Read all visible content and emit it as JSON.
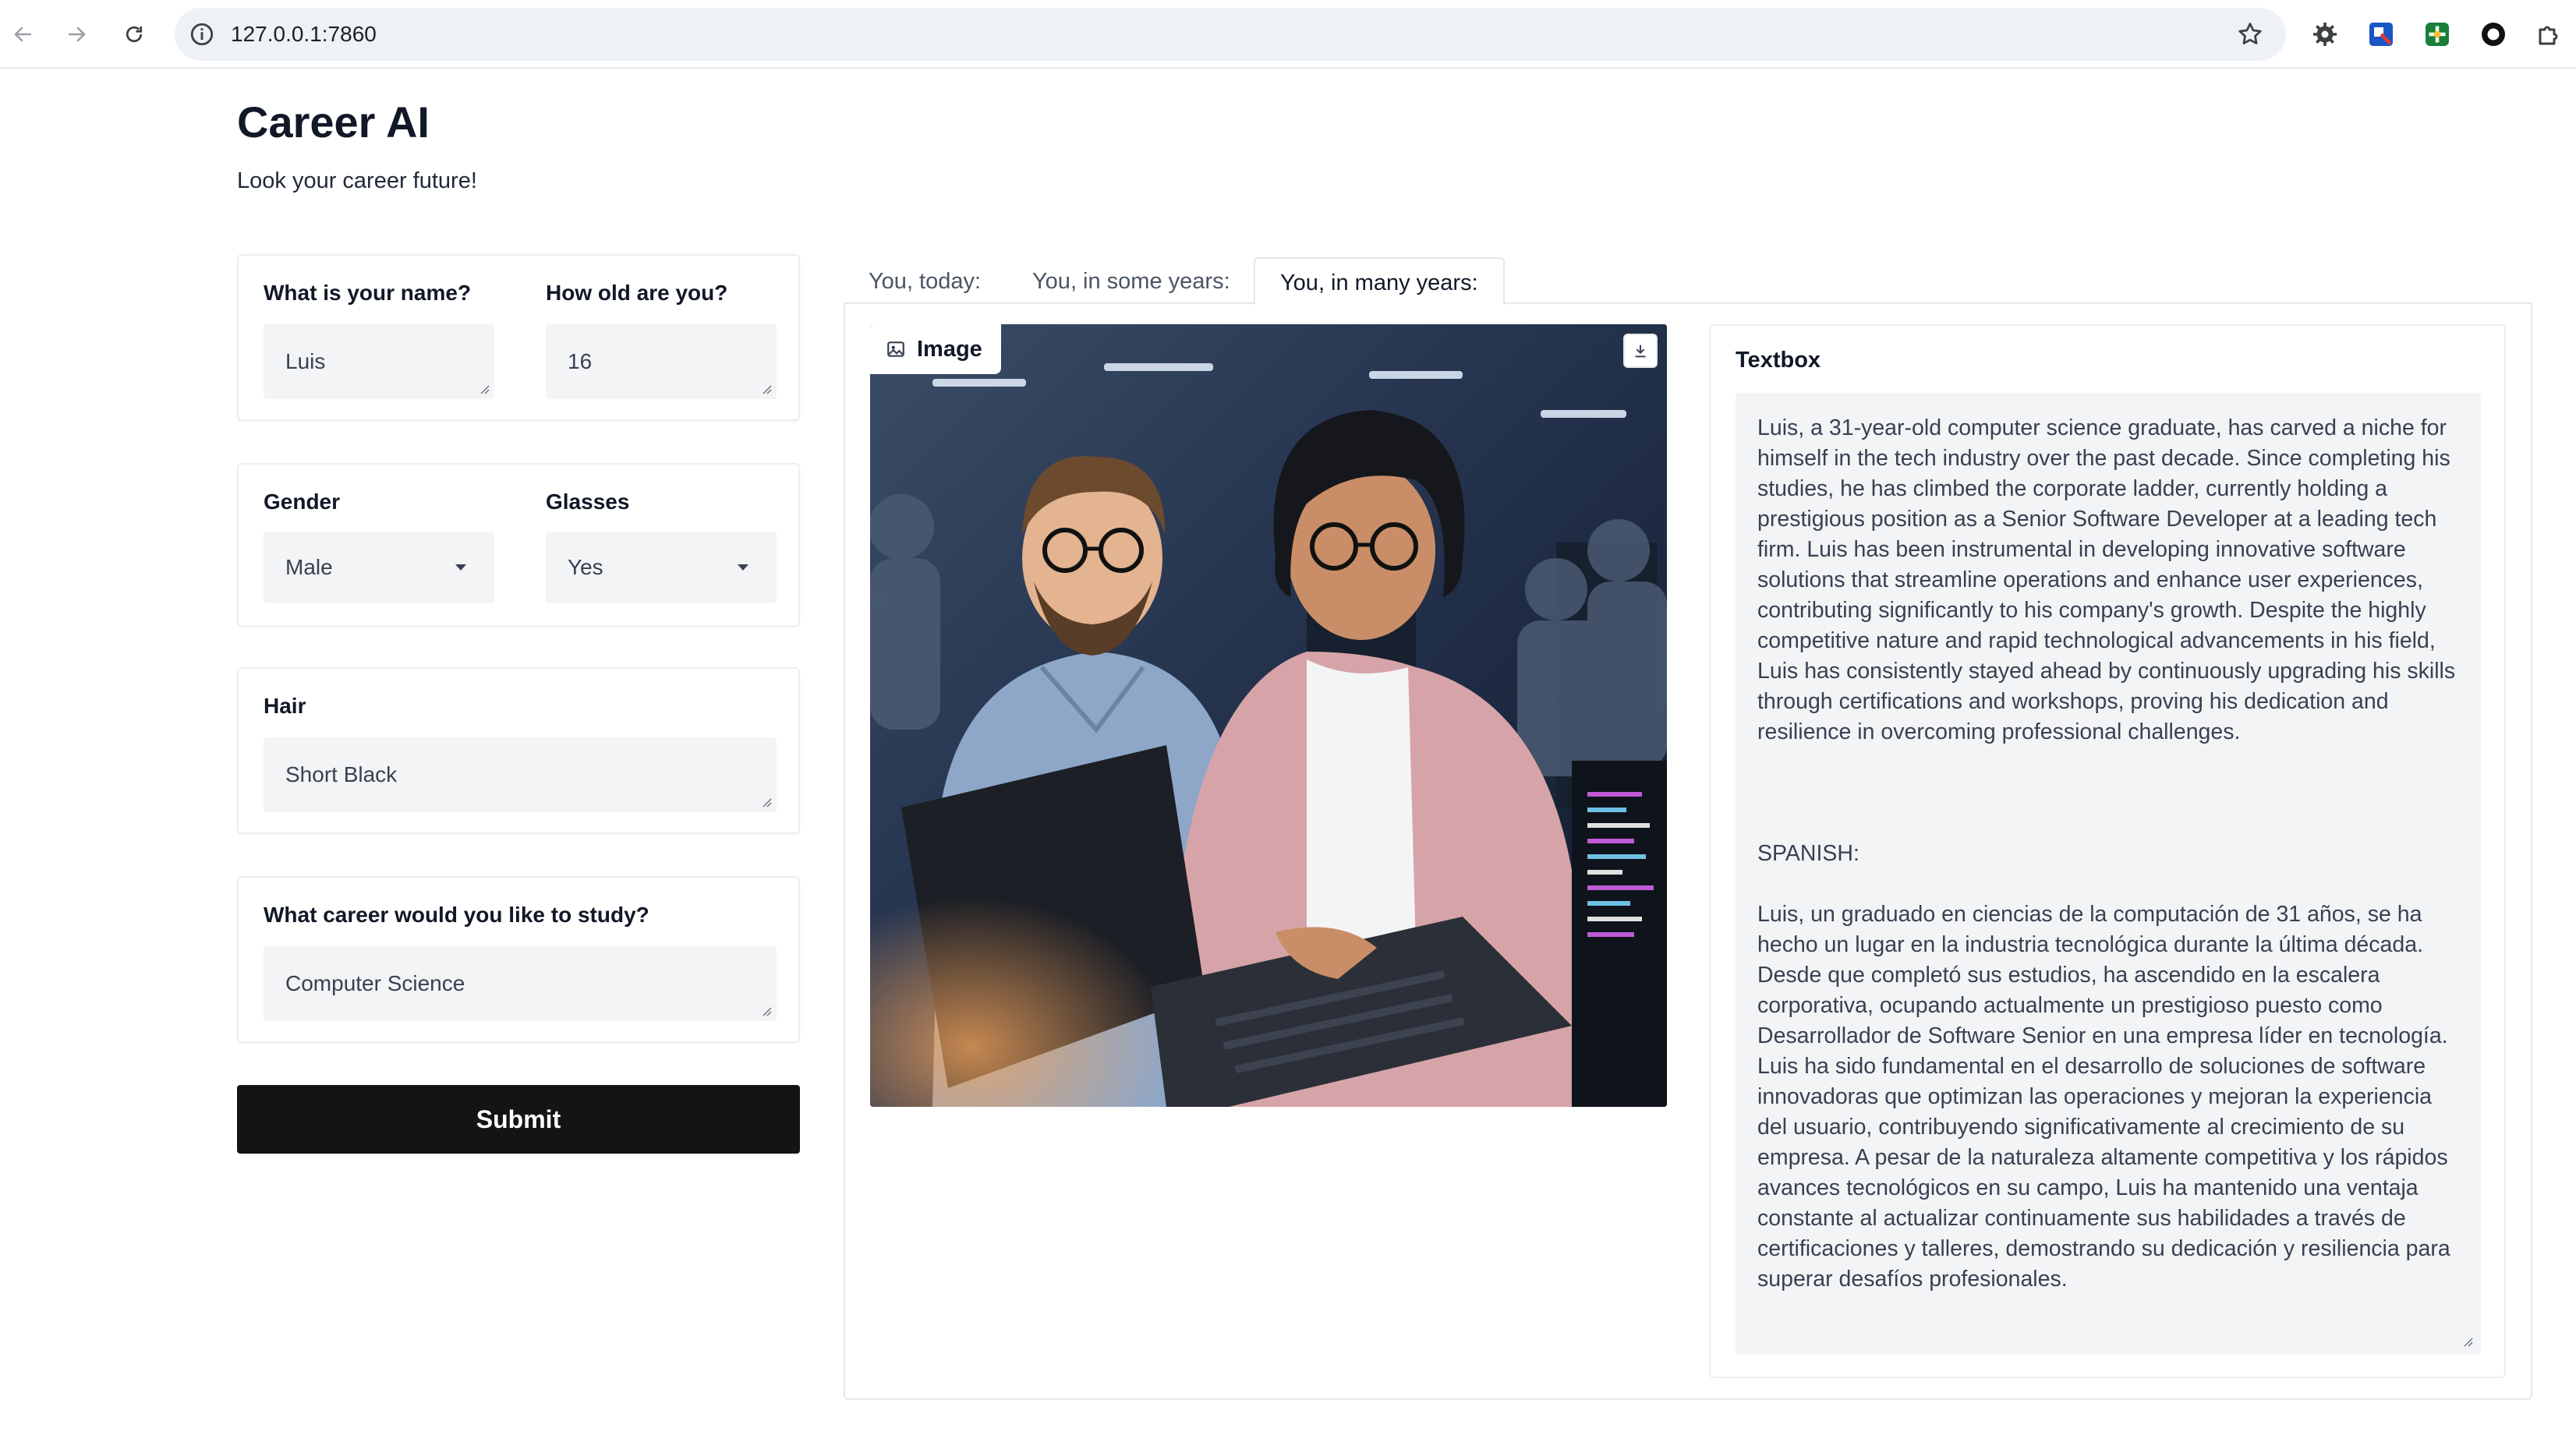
{
  "browser": {
    "url": "127.0.0.1:7860",
    "icons": [
      "back-arrow-icon",
      "forward-arrow-icon",
      "reload-icon",
      "info-icon",
      "star-icon",
      "settings-gear-icon",
      "extension-blue-icon",
      "extension-green-icon",
      "extension-circle-icon",
      "puzzle-icon"
    ]
  },
  "app": {
    "title": "Career AI",
    "subtitle": "Look your career future!"
  },
  "form": {
    "name_label": "What is your name?",
    "name_value": "Luis",
    "age_label": "How old are you?",
    "age_value": "16",
    "gender_label": "Gender",
    "gender_value": "Male",
    "glasses_label": "Glasses",
    "glasses_value": "Yes",
    "hair_label": "Hair",
    "hair_value": "Short Black",
    "career_label": "What career would you like to study?",
    "career_value": "Computer Science",
    "submit_label": "Submit"
  },
  "tabs": [
    {
      "label": "You, today:",
      "active": false
    },
    {
      "label": "You, in some years:",
      "active": false
    },
    {
      "label": "You, in many years:",
      "active": true
    }
  ],
  "output": {
    "image_label": "Image",
    "textbox_label": "Textbox",
    "text": "Luis, a 31-year-old computer science graduate, has carved a niche for himself in the tech industry over the past decade. Since completing his studies, he has climbed the corporate ladder, currently holding a prestigious position as a Senior Software Developer at a leading tech firm. Luis has been instrumental in developing innovative software solutions that streamline operations and enhance user experiences, contributing significantly to his company's growth. Despite the highly competitive nature and rapid technological advancements in his field, Luis has consistently stayed ahead by continuously upgrading his skills through certifications and workshops, proving his dedication and resilience in overcoming professional challenges.\n\n\n\nSPANISH:\n\nLuis, un graduado en ciencias de la computación de 31 años, se ha hecho un lugar en la industria tecnológica durante la última década. Desde que completó sus estudios, ha ascendido en la escalera corporativa, ocupando actualmente un prestigioso puesto como Desarrollador de Software Senior en una empresa líder en tecnología. Luis ha sido fundamental en el desarrollo de soluciones de software innovadoras que optimizan las operaciones y mejoran la experiencia del usuario, contribuyendo significativamente al crecimiento de su empresa. A pesar de la naturaleza altamente competitiva y los rápidos avances tecnológicos en su campo, Luis ha mantenido una ventaja constante al actualizar continuamente sus habilidades a través de certificaciones y talleres, demostrando su dedicación y resiliencia para superar desafíos profesionales."
  }
}
